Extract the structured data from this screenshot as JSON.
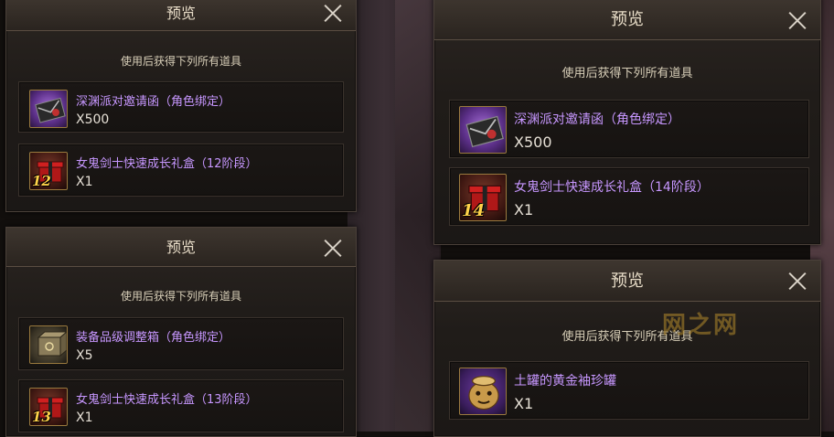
{
  "common": {
    "title": "预览",
    "subtitle": "使用后获得下列所有道具"
  },
  "panels": [
    {
      "items": [
        {
          "name": "深渊派对邀请函（角色绑定）",
          "qty": "X500",
          "icon": "invitation-icon"
        },
        {
          "name": "女鬼剑士快速成长礼盒（12阶段）",
          "qty": "X1",
          "icon": "gift-box-icon",
          "tier": "12"
        }
      ]
    },
    {
      "items": [
        {
          "name": "深渊派对邀请函（角色绑定）",
          "qty": "X500",
          "icon": "invitation-icon"
        },
        {
          "name": "女鬼剑士快速成长礼盒（14阶段）",
          "qty": "X1",
          "icon": "gift-box-icon",
          "tier": "14"
        }
      ]
    },
    {
      "items": [
        {
          "name": "装备品级调整箱（角色绑定）",
          "qty": "X5",
          "icon": "equipment-box-icon"
        },
        {
          "name": "女鬼剑士快速成长礼盒（13阶段）",
          "qty": "X1",
          "icon": "gift-box-icon",
          "tier": "13"
        }
      ]
    },
    {
      "items": [
        {
          "name": "土罐的黄金袖珍罐",
          "qty": "X1",
          "icon": "golden-jar-icon"
        }
      ]
    }
  ],
  "watermark": "网之网",
  "colors": {
    "item_name": "#c797ff",
    "tier_text": "#ffd24a"
  }
}
